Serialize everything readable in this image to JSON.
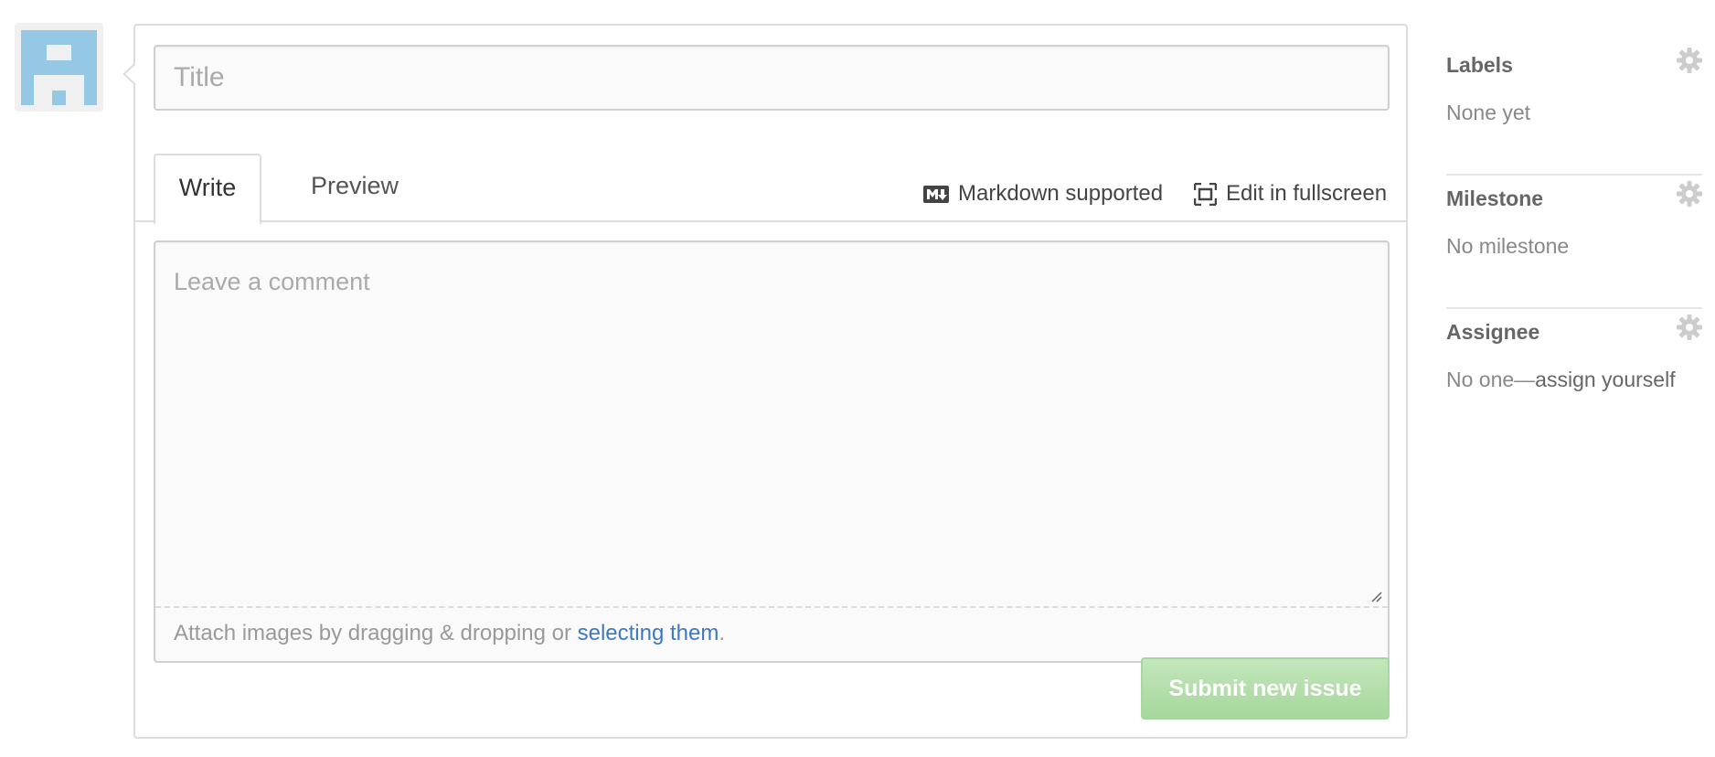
{
  "composer": {
    "title_placeholder": "Title",
    "tabs": [
      {
        "label": "Write",
        "active": true
      },
      {
        "label": "Preview",
        "active": false
      }
    ],
    "markdown_label": "Markdown supported",
    "fullscreen_label": "Edit in fullscreen",
    "comment_placeholder": "Leave a comment",
    "attach_text": "Attach images by dragging & dropping or ",
    "attach_link": "selecting them",
    "attach_suffix": ".",
    "submit_label": "Submit new issue"
  },
  "sidebar": {
    "labels": {
      "heading": "Labels",
      "value": "None yet"
    },
    "milestone": {
      "heading": "Milestone",
      "value": "No milestone"
    },
    "assignee": {
      "heading": "Assignee",
      "value": "No one—",
      "link": "assign yourself"
    }
  },
  "icons": {
    "avatar": "identicon",
    "markdown": "markdown-icon",
    "fullscreen": "fullscreen-icon",
    "gear": "gear-icon"
  },
  "colors": {
    "link": "#4078c0",
    "submit_bg": "#a6d79c",
    "avatar_blue": "#94c8e4"
  }
}
